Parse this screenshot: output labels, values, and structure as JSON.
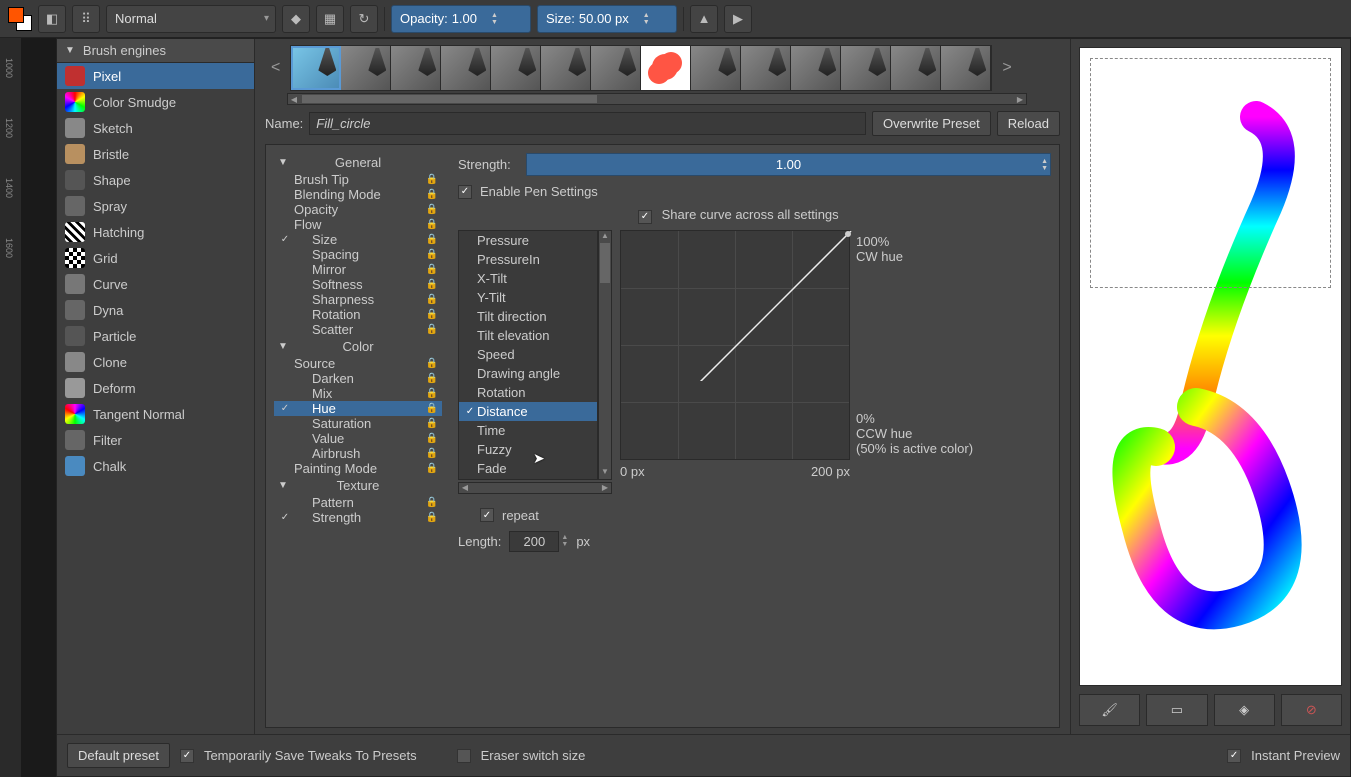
{
  "topbar": {
    "blend_mode": "Normal",
    "opacity_label": "Opacity:",
    "opacity_value": "1.00",
    "size_label": "Size:",
    "size_value": "50.00 px"
  },
  "engines": {
    "header": "Brush engines",
    "items": [
      {
        "label": "Pixel",
        "selected": true,
        "color": "#c03030"
      },
      {
        "label": "Color Smudge",
        "color": "conic"
      },
      {
        "label": "Sketch",
        "color": "#888"
      },
      {
        "label": "Bristle",
        "color": "#b89060"
      },
      {
        "label": "Shape",
        "color": "#555"
      },
      {
        "label": "Spray",
        "color": "#666"
      },
      {
        "label": "Hatching",
        "color": "stripes"
      },
      {
        "label": "Grid",
        "color": "checker"
      },
      {
        "label": "Curve",
        "color": "#777"
      },
      {
        "label": "Dyna",
        "color": "#666"
      },
      {
        "label": "Particle",
        "color": "#555"
      },
      {
        "label": "Clone",
        "color": "#888"
      },
      {
        "label": "Deform",
        "color": "#999"
      },
      {
        "label": "Tangent Normal",
        "color": "conic2"
      },
      {
        "label": "Filter",
        "color": "#666"
      },
      {
        "label": "Chalk",
        "color": "#4a8ac0"
      }
    ]
  },
  "preset": {
    "name_label": "Name:",
    "name_value": "Fill_circle",
    "overwrite": "Overwrite Preset",
    "reload": "Reload"
  },
  "options": {
    "groups": [
      {
        "header": "General",
        "items": [
          {
            "label": "Brush Tip"
          },
          {
            "label": "Blending Mode"
          },
          {
            "label": "Opacity"
          },
          {
            "label": "Flow"
          },
          {
            "label": "Size",
            "checked": true,
            "indent": true
          },
          {
            "label": "Spacing",
            "indent": true
          },
          {
            "label": "Mirror",
            "indent": true
          },
          {
            "label": "Softness",
            "indent": true
          },
          {
            "label": "Sharpness",
            "indent": true
          },
          {
            "label": "Rotation",
            "indent": true
          },
          {
            "label": "Scatter",
            "indent": true
          }
        ]
      },
      {
        "header": "Color",
        "items": [
          {
            "label": "Source"
          },
          {
            "label": "Darken",
            "indent": true
          },
          {
            "label": "Mix",
            "indent": true
          },
          {
            "label": "Hue",
            "checked": true,
            "indent": true,
            "selected": true
          },
          {
            "label": "Saturation",
            "indent": true
          },
          {
            "label": "Value",
            "indent": true
          },
          {
            "label": "Airbrush",
            "indent": true
          },
          {
            "label": "Painting Mode"
          }
        ]
      },
      {
        "header": "Texture",
        "items": [
          {
            "label": "Pattern",
            "indent": true
          },
          {
            "label": "Strength",
            "checked": true,
            "indent": true
          }
        ]
      }
    ]
  },
  "settings": {
    "strength_label": "Strength:",
    "strength_value": "1.00",
    "enable_pen": "Enable Pen Settings",
    "share_curve": "Share curve across all settings",
    "sensors": [
      {
        "label": "Pressure"
      },
      {
        "label": "PressureIn"
      },
      {
        "label": "X-Tilt"
      },
      {
        "label": "Y-Tilt"
      },
      {
        "label": "Tilt direction"
      },
      {
        "label": "Tilt elevation"
      },
      {
        "label": "Speed"
      },
      {
        "label": "Drawing angle"
      },
      {
        "label": "Rotation"
      },
      {
        "label": "Distance",
        "checked": true,
        "selected": true
      },
      {
        "label": "Time"
      },
      {
        "label": "Fuzzy"
      },
      {
        "label": "Fade"
      }
    ],
    "curve": {
      "top_label_1": "100%",
      "top_label_2": "CW hue",
      "bot_label_1": "0%",
      "bot_label_2": "CCW hue",
      "bot_label_3": "(50% is active color)",
      "x_min": "0 px",
      "x_max": "200 px"
    },
    "repeat_label": "repeat",
    "length_label": "Length:",
    "length_value": "200",
    "length_unit": "px"
  },
  "bottom": {
    "default_preset": "Default preset",
    "temp_save": "Temporarily Save Tweaks To Presets",
    "eraser": "Eraser switch size",
    "instant": "Instant Preview"
  },
  "ruler_ticks": [
    "1000",
    "1200",
    "1400",
    "1600"
  ]
}
